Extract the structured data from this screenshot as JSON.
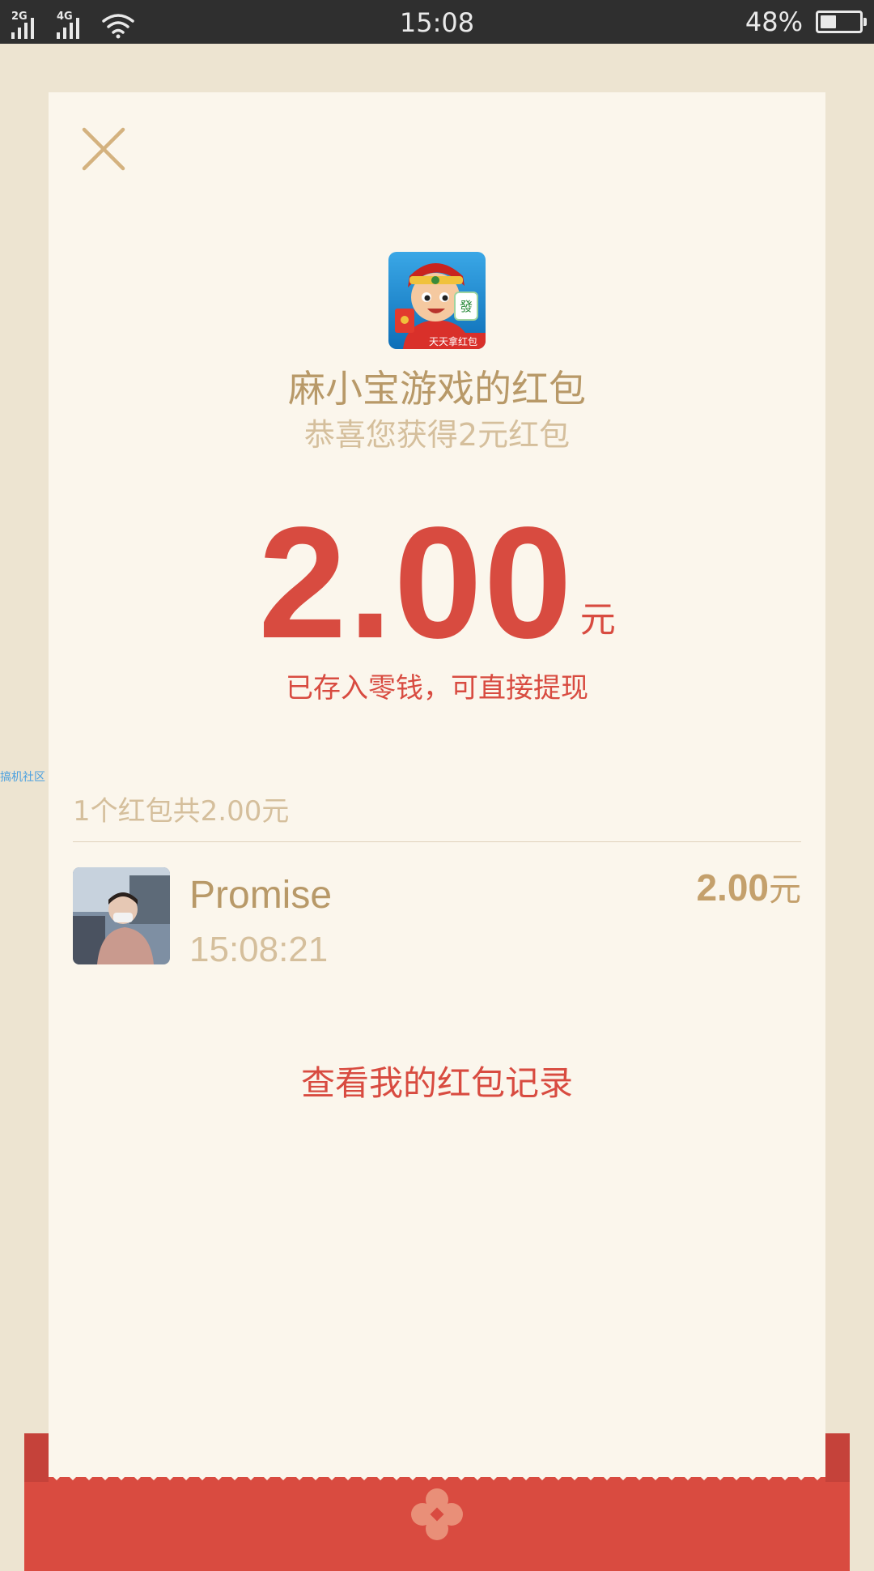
{
  "status_bar": {
    "network_1": "2G",
    "network_2": "4G",
    "time": "15:08",
    "battery_percent": "48%",
    "battery_level": 0.48
  },
  "red_packet": {
    "sender_title": "麻小宝游戏的红包",
    "greeting": "恭喜您获得2元红包",
    "app_icon_caption": "天天拿红包",
    "amount": "2.00",
    "amount_unit": "元",
    "deposit_note": "已存入零钱，可直接提现"
  },
  "watermark": "搞机社区",
  "summary": "1个红包共2.00元",
  "records": [
    {
      "name": "Promise",
      "time": "15:08:21",
      "amount": "2.00",
      "unit": "元"
    }
  ],
  "view_records_label": "查看我的红包记录",
  "colors": {
    "background": "#ede4d1",
    "paper": "#fbf6ec",
    "gold": "#b89968",
    "light_gold": "#d5bf9c",
    "red": "#d84b40",
    "status_bar": "#2f2f2f"
  }
}
